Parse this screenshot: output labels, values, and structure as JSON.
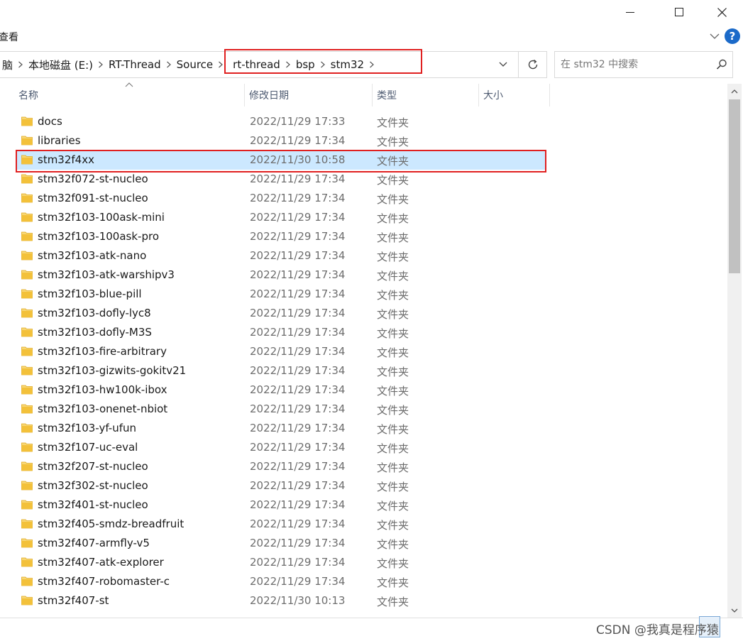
{
  "ribbon": {
    "tab_view": "查看"
  },
  "breadcrumb": {
    "items": [
      {
        "label": "脑"
      },
      {
        "label": "本地磁盘 (E:)"
      },
      {
        "label": "RT-Thread"
      },
      {
        "label": "Source"
      },
      {
        "label": "rt-thread"
      },
      {
        "label": "bsp"
      },
      {
        "label": "stm32"
      }
    ]
  },
  "search": {
    "placeholder": "在 stm32 中搜索"
  },
  "columns": {
    "name": "名称",
    "date": "修改日期",
    "type": "类型",
    "size": "大小"
  },
  "files": [
    {
      "name": "docs",
      "date": "2022/11/29 17:33",
      "type": "文件夹"
    },
    {
      "name": "libraries",
      "date": "2022/11/29 17:34",
      "type": "文件夹"
    },
    {
      "name": "stm32f4xx",
      "date": "2022/11/30 10:58",
      "type": "文件夹",
      "selected": true
    },
    {
      "name": "stm32f072-st-nucleo",
      "date": "2022/11/29 17:34",
      "type": "文件夹"
    },
    {
      "name": "stm32f091-st-nucleo",
      "date": "2022/11/29 17:34",
      "type": "文件夹"
    },
    {
      "name": "stm32f103-100ask-mini",
      "date": "2022/11/29 17:34",
      "type": "文件夹"
    },
    {
      "name": "stm32f103-100ask-pro",
      "date": "2022/11/29 17:34",
      "type": "文件夹"
    },
    {
      "name": "stm32f103-atk-nano",
      "date": "2022/11/29 17:34",
      "type": "文件夹"
    },
    {
      "name": "stm32f103-atk-warshipv3",
      "date": "2022/11/29 17:34",
      "type": "文件夹"
    },
    {
      "name": "stm32f103-blue-pill",
      "date": "2022/11/29 17:34",
      "type": "文件夹"
    },
    {
      "name": "stm32f103-dofly-lyc8",
      "date": "2022/11/29 17:34",
      "type": "文件夹"
    },
    {
      "name": "stm32f103-dofly-M3S",
      "date": "2022/11/29 17:34",
      "type": "文件夹"
    },
    {
      "name": "stm32f103-fire-arbitrary",
      "date": "2022/11/29 17:34",
      "type": "文件夹"
    },
    {
      "name": "stm32f103-gizwits-gokitv21",
      "date": "2022/11/29 17:34",
      "type": "文件夹"
    },
    {
      "name": "stm32f103-hw100k-ibox",
      "date": "2022/11/29 17:34",
      "type": "文件夹"
    },
    {
      "name": "stm32f103-onenet-nbiot",
      "date": "2022/11/29 17:34",
      "type": "文件夹"
    },
    {
      "name": "stm32f103-yf-ufun",
      "date": "2022/11/29 17:34",
      "type": "文件夹"
    },
    {
      "name": "stm32f107-uc-eval",
      "date": "2022/11/29 17:34",
      "type": "文件夹"
    },
    {
      "name": "stm32f207-st-nucleo",
      "date": "2022/11/29 17:34",
      "type": "文件夹"
    },
    {
      "name": "stm32f302-st-nucleo",
      "date": "2022/11/29 17:34",
      "type": "文件夹"
    },
    {
      "name": "stm32f401-st-nucleo",
      "date": "2022/11/29 17:34",
      "type": "文件夹"
    },
    {
      "name": "stm32f405-smdz-breadfruit",
      "date": "2022/11/29 17:34",
      "type": "文件夹"
    },
    {
      "name": "stm32f407-armfly-v5",
      "date": "2022/11/29 17:34",
      "type": "文件夹"
    },
    {
      "name": "stm32f407-atk-explorer",
      "date": "2022/11/29 17:34",
      "type": "文件夹"
    },
    {
      "name": "stm32f407-robomaster-c",
      "date": "2022/11/29 17:34",
      "type": "文件夹"
    },
    {
      "name": "stm32f407-st",
      "date": "2022/11/30 10:13",
      "type": "文件夹"
    }
  ],
  "watermark": "CSDN @我真是程序猿",
  "colors": {
    "selection": "#cce8ff",
    "highlight_box": "#e02020",
    "folder": "#f3c13a",
    "help": "#1b6ac9"
  }
}
